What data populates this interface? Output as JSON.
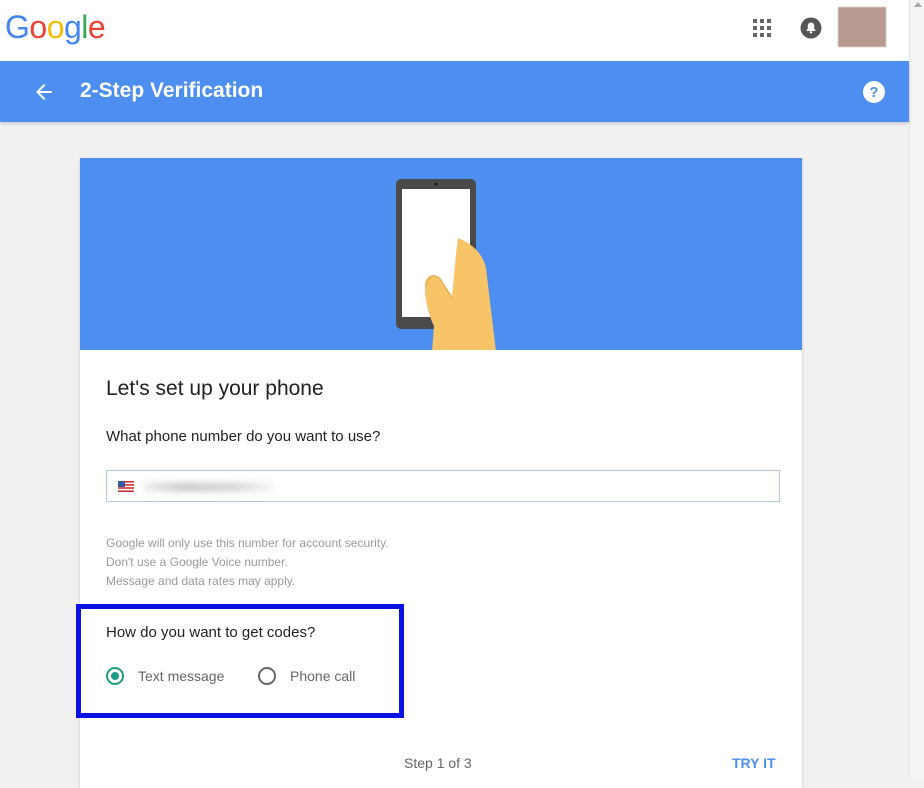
{
  "app": {
    "logo_letters": [
      {
        "ch": "G",
        "color": "#4285f4"
      },
      {
        "ch": "o",
        "color": "#ea4335"
      },
      {
        "ch": "o",
        "color": "#fbbc05"
      },
      {
        "ch": "g",
        "color": "#4285f4"
      },
      {
        "ch": "l",
        "color": "#34a853"
      },
      {
        "ch": "e",
        "color": "#ea4335"
      }
    ],
    "icons": {
      "apps": "apps-grid-icon",
      "notifications": "notifications-icon",
      "avatar": "avatar"
    }
  },
  "header": {
    "title": "2-Step Verification",
    "back_icon": "arrow-left-icon",
    "help_icon": "help-icon",
    "color": "#4d8ff0"
  },
  "card": {
    "title": "Let's set up your phone",
    "phone_question": "What phone number do you want to use?",
    "phone_input": {
      "country_flag": "us-flag-icon",
      "value": ""
    },
    "info_lines": [
      "Google will only use this number for account security.",
      "Don't use a Google Voice number.",
      "Message and data rates may apply."
    ],
    "codes_question": "How do you want to get codes?",
    "options": [
      {
        "label": "Text message",
        "checked": true
      },
      {
        "label": "Phone call",
        "checked": false
      }
    ],
    "step": "Step 1 of 3",
    "action": "TRY IT",
    "accent": "#1b9c85",
    "highlight_color": "#0a12e6"
  }
}
